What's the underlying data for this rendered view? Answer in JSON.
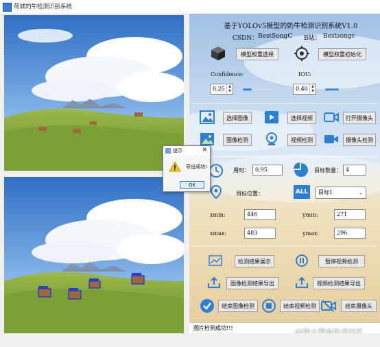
{
  "window": {
    "title": "荷城的牛检测识别系统"
  },
  "header": {
    "title": "基于YOLOv5模型的奶牛检测识别系统V1.0",
    "csdn_label": "CSDN：",
    "csdn_value": "BestSongC",
    "bilibili_label": "B站：",
    "bilibili_value": "Bestsongc"
  },
  "model": {
    "select_label": "模型权重选择",
    "init_label": "模型权重初始化"
  },
  "params": {
    "confidence_label": "Confidence:",
    "confidence_value": "0.25",
    "confidence_fraction": 0.25,
    "iou_label": "IOU:",
    "iou_value": "0.40",
    "iou_fraction": 0.4
  },
  "actions": {
    "select_image": "选择图像",
    "select_video": "选择视频",
    "open_camera": "打开摄像头",
    "image_detect": "图像检测",
    "video_detect": "视频检测",
    "camera_detect": "摄像头检测"
  },
  "results": {
    "time_label": "用时：",
    "time_value": "0.95",
    "count_label": "目标数量：",
    "count_value": "4",
    "position_label": "目标位置：",
    "target_select": "目标1",
    "xmin_label": "xmin:",
    "xmin_value": "446",
    "ymin_label": "ymin:",
    "ymin_value": "271",
    "xmax_label": "xmax:",
    "xmax_value": "483",
    "ymax_label": "ymax:",
    "ymax_value": "296"
  },
  "bottom_actions": {
    "show_results": "检测结果展示",
    "pause_video": "暂停视频检测",
    "export_image": "图像检测结果导出",
    "export_video": "视频检测结果导出",
    "end_image": "结束图像检测",
    "end_video": "结束视频检测",
    "end_camera": "结束摄像头"
  },
  "status": {
    "text": "图片检测成功!!!"
  },
  "dialog": {
    "title": "提示",
    "message": "导出成功!",
    "ok": "OK"
  },
  "watermark": "@稀土掘金技术社区",
  "detections": [
    {
      "label": "cow"
    },
    {
      "label": "cow"
    },
    {
      "label": "cow"
    },
    {
      "label": "cow"
    }
  ],
  "colors": {
    "accent": "#2d7fd6",
    "dialog_border": "#2f7ad6",
    "warning": "#f2c417"
  }
}
